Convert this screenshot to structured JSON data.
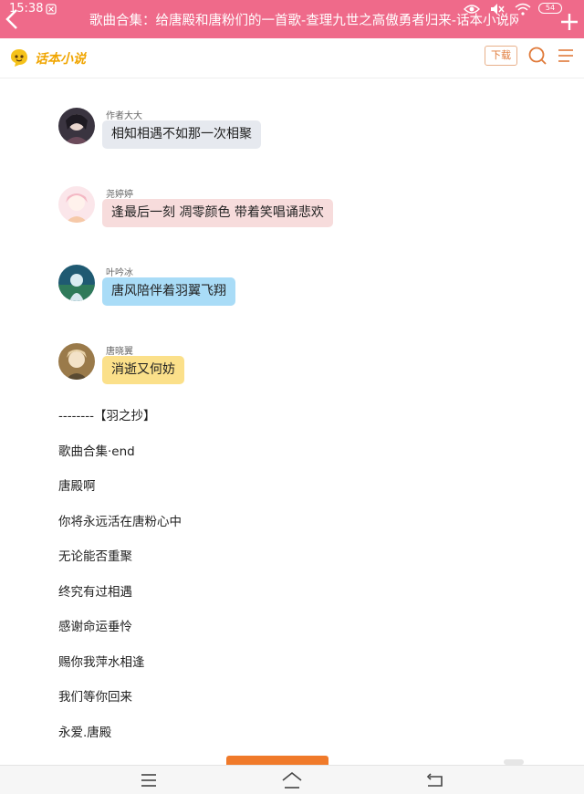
{
  "status_bar": {
    "time": "15:38",
    "battery": "54"
  },
  "browser": {
    "title": "歌曲合集：给唐殿和唐粉们的一首歌-查理九世之高傲勇者归来-话本小说网"
  },
  "site_header": {
    "logo_text": "话本小说",
    "download_label": "下载"
  },
  "messages": [
    {
      "name": "作者大大",
      "text": "相知相遇不如那一次相聚",
      "bubble_color": "#e6e9ef"
    },
    {
      "name": "尧婷婷",
      "text": "逢最后一刻 凋零颜色 带着笑唱诵悲欢",
      "bubble_color": "#f7dcdc"
    },
    {
      "name": "叶吟冰",
      "text": "唐风陪伴着羽翼飞翔",
      "bubble_color": "#a9dcf7"
    },
    {
      "name": "唐晓翼",
      "text": "消逝又何妨",
      "bubble_color": "#fbe08a"
    }
  ],
  "text_lines": [
    "--------【羽之抄】",
    "歌曲合集·end",
    "唐殿啊",
    "你将永远活在唐粉心中",
    "无论能否重聚",
    "终究有过相遇",
    "感谢命运垂怜",
    "赐你我萍水相逢",
    "我们等你回来",
    "永爱.唐殿"
  ],
  "colors": {
    "top_bar": "#ef6a8a",
    "accent_orange": "#f07a2a"
  }
}
